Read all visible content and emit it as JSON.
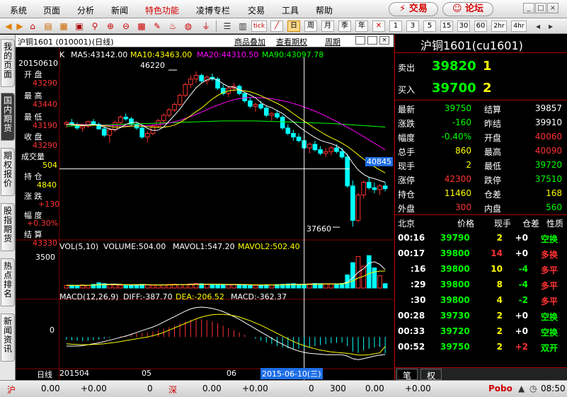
{
  "menu": [
    "系统",
    "页面",
    "分析",
    "新闻",
    "特色功能",
    "凌博专栏",
    "交易",
    "工具",
    "帮助"
  ],
  "menu_highlight_index": 4,
  "top_buttons": {
    "trade": "⚡ 交易",
    "forum": "论坛"
  },
  "toolbar_numbers": [
    "1",
    "3",
    "5",
    "15",
    "30",
    "60",
    "2hr",
    "4hr"
  ],
  "toolbar_day": "日",
  "toolbar_week": "周",
  "toolbar_month": "月",
  "toolbar_season": "季",
  "toolbar_year": "年",
  "toolbar_tick": "tick",
  "left_tabs": [
    "我的页面",
    "国内期货",
    "期权报价",
    "股指期货",
    "热点排名",
    "新闻资讯"
  ],
  "left_tab_active": 1,
  "chart_header": {
    "title": "沪铜1601 (010001)",
    "period": "(日线)",
    "link1": "商品叠加",
    "link2": "查看期权",
    "link3": "周期"
  },
  "chart_data": [
    {
      "type": "candlestick",
      "name": "K",
      "ma_labels": [
        {
          "text": "MA5:43142.00",
          "color": "#ffffff"
        },
        {
          "text": "MA10:43463.00",
          "color": "#ffff00"
        },
        {
          "text": "MA20:44310.50",
          "color": "#ff00ff"
        },
        {
          "text": "MA90:43097.78",
          "color": "#00ff00"
        }
      ],
      "y_cursor_value": "40845",
      "annotation_high": "46220",
      "annotation_low": "37660",
      "x_labels": [
        "201504",
        "05",
        "06"
      ],
      "cursor_date": "2015-06-10(三)",
      "candles": [
        [
          43300,
          43500,
          43100,
          43400
        ],
        [
          43400,
          43600,
          43200,
          43300
        ],
        [
          43300,
          43400,
          43000,
          43100
        ],
        [
          43100,
          43300,
          42900,
          43200
        ],
        [
          43200,
          43500,
          43100,
          43450
        ],
        [
          43450,
          43600,
          43250,
          43300
        ],
        [
          43300,
          43400,
          43000,
          43050
        ],
        [
          43050,
          43200,
          42600,
          42700
        ],
        [
          42700,
          43100,
          42300,
          43000
        ],
        [
          43000,
          43500,
          42900,
          43400
        ],
        [
          43400,
          43800,
          43300,
          43700
        ],
        [
          43700,
          43900,
          43500,
          43600
        ],
        [
          43600,
          43700,
          43200,
          43300
        ],
        [
          43300,
          43400,
          43000,
          43100
        ],
        [
          43100,
          43200,
          42500,
          42600
        ],
        [
          42600,
          42900,
          42300,
          42800
        ],
        [
          42800,
          43300,
          42700,
          43200
        ],
        [
          43200,
          43600,
          43100,
          43500
        ],
        [
          43500,
          43900,
          43400,
          43800
        ],
        [
          43800,
          44200,
          43700,
          44100
        ],
        [
          44100,
          44500,
          44000,
          44400
        ],
        [
          44400,
          45000,
          44300,
          44900
        ],
        [
          44900,
          45600,
          44800,
          45500
        ],
        [
          45500,
          46000,
          45300,
          45800
        ],
        [
          45800,
          46220,
          45600,
          46000
        ],
        [
          46000,
          46100,
          45600,
          45700
        ],
        [
          45700,
          46000,
          45500,
          45900
        ],
        [
          45900,
          46100,
          45700,
          45800
        ],
        [
          45800,
          45900,
          45200,
          45300
        ],
        [
          45300,
          45500,
          44900,
          45000
        ],
        [
          45000,
          45400,
          44800,
          45300
        ],
        [
          45300,
          45600,
          45100,
          45400
        ],
        [
          45400,
          45500,
          44900,
          45000
        ],
        [
          45000,
          45100,
          44500,
          44600
        ],
        [
          44600,
          44800,
          44200,
          44300
        ],
        [
          44300,
          44500,
          44000,
          44400
        ],
        [
          44400,
          44600,
          44100,
          44200
        ],
        [
          44200,
          44300,
          43700,
          43800
        ],
        [
          43800,
          44000,
          43500,
          43900
        ],
        [
          43900,
          44100,
          43600,
          43700
        ],
        [
          43700,
          43800,
          43000,
          43100
        ],
        [
          43100,
          43300,
          42700,
          42800
        ],
        [
          42800,
          43000,
          42400,
          42600
        ],
        [
          42600,
          42800,
          42300,
          42400
        ],
        [
          42400,
          42700,
          41900,
          42000
        ],
        [
          42000,
          42300,
          41700,
          42200
        ],
        [
          42200,
          42400,
          41800,
          41900
        ],
        [
          41900,
          42100,
          41600,
          41700
        ],
        [
          41700,
          42000,
          41500,
          41800
        ],
        [
          41800,
          42100,
          41600,
          42000
        ],
        [
          42000,
          42200,
          41700,
          41800
        ],
        [
          41800,
          42000,
          41400,
          41500
        ],
        [
          41500,
          41700,
          39800,
          39900
        ],
        [
          39900,
          40200,
          37660,
          38000
        ],
        [
          38000,
          39500,
          37900,
          39400
        ],
        [
          39400,
          40200,
          39200,
          40100
        ],
        [
          40100,
          40400,
          39700,
          39800
        ],
        [
          39800,
          40100,
          39500,
          39700
        ],
        [
          39700,
          40000,
          39400,
          39900
        ],
        [
          39900,
          40100,
          39600,
          39750
        ]
      ],
      "ma5": [
        43300,
        43280,
        43250,
        43230,
        43260,
        43300,
        43260,
        43150,
        43050,
        43000,
        43120,
        43300,
        43400,
        43420,
        43260,
        43080,
        42960,
        42980,
        43160,
        43480,
        43800,
        44140,
        44560,
        44940,
        45320,
        45580,
        45760,
        45840,
        45740,
        45540,
        45380,
        45360,
        45200,
        45060,
        44920,
        44760,
        44500,
        44320,
        44220,
        44060,
        43900,
        43660,
        43440,
        43180,
        42960,
        42760,
        42580,
        42420,
        42320,
        42240,
        42120,
        41920,
        41600,
        41160,
        40780,
        40540,
        40380,
        40300,
        40200,
        40100
      ],
      "ma10": [
        43300,
        43300,
        43280,
        43260,
        43260,
        43260,
        43250,
        43220,
        43180,
        43150,
        43150,
        43170,
        43200,
        43220,
        43200,
        43170,
        43140,
        43130,
        43140,
        43180,
        43260,
        43400,
        43580,
        43780,
        44000,
        44200,
        44450,
        44700,
        44900,
        45050,
        45150,
        45200,
        45200,
        45150,
        45100,
        45000,
        44880,
        44740,
        44600,
        44460,
        44300,
        44100,
        43890,
        43680,
        43480,
        43280,
        43080,
        42900,
        42720,
        42560,
        42420,
        42260,
        42080,
        41860,
        41620,
        41380,
        41160,
        40960,
        40780,
        40620
      ],
      "ma20": [
        43300,
        43300,
        43300,
        43290,
        43280,
        43270,
        43260,
        43250,
        43240,
        43230,
        43220,
        43210,
        43210,
        43220,
        43230,
        43240,
        43260,
        43290,
        43330,
        43380,
        43440,
        43520,
        43620,
        43730,
        43850,
        43980,
        44110,
        44240,
        44360,
        44470,
        44570,
        44660,
        44720,
        44760,
        44780,
        44780,
        44770,
        44750,
        44710,
        44660,
        44600,
        44530,
        44450,
        44360,
        44260,
        44150,
        44030,
        43900,
        43760,
        43610,
        43460,
        43300,
        43140,
        42970,
        42800,
        42620,
        42440,
        42260,
        42080,
        41900
      ],
      "ma90": [
        43200,
        43210,
        43220,
        43230,
        43240,
        43250,
        43260,
        43270,
        43280,
        43290,
        43300,
        43310,
        43320,
        43330,
        43340,
        43350,
        43360,
        43370,
        43380,
        43390,
        43400,
        43410,
        43420,
        43430,
        43440,
        43450,
        43460,
        43470,
        43480,
        43490,
        43490,
        43490,
        43490,
        43490,
        43490,
        43490,
        43480,
        43470,
        43460,
        43450,
        43440,
        43430,
        43420,
        43410,
        43400,
        43390,
        43380,
        43370,
        43360,
        43350,
        43330,
        43310,
        43290,
        43270,
        43250,
        43230,
        43210,
        43190,
        43170,
        43150
      ],
      "y_range": [
        37000,
        47000
      ]
    },
    {
      "type": "bar",
      "name": "VOL",
      "label": "VOL(5,10)",
      "volume_label": "VOLUME:504.00",
      "mavol1_label": "MAVOL1:547.20",
      "mavol2_label": "MAVOL2:502.40",
      "y_tick": "3500",
      "values": [
        300,
        320,
        280,
        350,
        300,
        420,
        600,
        500,
        380,
        360,
        300,
        320,
        340,
        380,
        420,
        360,
        300,
        340,
        380,
        420,
        440,
        400,
        380,
        460,
        520,
        480,
        400,
        380,
        420,
        360,
        340,
        380,
        400,
        360,
        320,
        300,
        340,
        380,
        360,
        400,
        420,
        460,
        500,
        380,
        420,
        480,
        520,
        500,
        460,
        440,
        480,
        520,
        1500,
        2900,
        3600,
        2500,
        3700,
        2300,
        1400,
        504
      ],
      "y_range": [
        0,
        4200
      ]
    },
    {
      "type": "bar",
      "name": "MACD",
      "label": "MACD(12,26,9)",
      "diff_label": "DIFF:-387.70",
      "dea_label": "DEA:-206.52",
      "macd_label": "MACD:-362.37",
      "y_tick": "0",
      "values": [
        -60,
        -70,
        -80,
        -90,
        -80,
        -70,
        -60,
        -40,
        -20,
        0,
        20,
        40,
        60,
        80,
        90,
        100,
        120,
        150,
        180,
        220,
        260,
        300,
        340,
        380,
        400,
        390,
        370,
        340,
        300,
        250,
        200,
        150,
        100,
        50,
        0,
        -40,
        -80,
        -120,
        -160,
        -200,
        -230,
        -250,
        -260,
        -260,
        -250,
        -230,
        -200,
        -180,
        -160,
        -140,
        -130,
        -120,
        -200,
        -320,
        -350,
        -300,
        -260,
        -230,
        -220,
        -362
      ],
      "diff": [
        -200,
        -200,
        -200,
        -190,
        -170,
        -150,
        -130,
        -100,
        -70,
        -40,
        -10,
        20,
        60,
        100,
        140,
        180,
        220,
        270,
        330,
        390,
        450,
        510,
        570,
        620,
        650,
        660,
        650,
        630,
        600,
        560,
        510,
        450,
        390,
        320,
        250,
        180,
        110,
        40,
        -30,
        -100,
        -160,
        -220,
        -270,
        -310,
        -340,
        -360,
        -370,
        -380,
        -390,
        -390,
        -390,
        -390,
        -420,
        -480,
        -500,
        -480,
        -450,
        -420,
        -400,
        -387
      ],
      "dea": [
        -150,
        -160,
        -165,
        -170,
        -170,
        -165,
        -160,
        -150,
        -135,
        -120,
        -100,
        -80,
        -60,
        -40,
        -20,
        0,
        30,
        60,
        100,
        150,
        200,
        250,
        300,
        350,
        400,
        440,
        470,
        490,
        500,
        500,
        490,
        470,
        440,
        400,
        360,
        310,
        260,
        200,
        140,
        80,
        20,
        -40,
        -100,
        -150,
        -190,
        -230,
        -260,
        -290,
        -310,
        -330,
        -340,
        -350,
        -360,
        -380,
        -400,
        -400,
        -390,
        -370,
        -350,
        -206
      ],
      "y_range": [
        -700,
        800
      ]
    }
  ],
  "y_axis_info": {
    "date": "20150610",
    "open_label": "开 盘",
    "open": "43290",
    "high_label": "最 高",
    "high": "43440",
    "low_label": "最 低",
    "low": "43190",
    "close_label": "收 盘",
    "close": "43290",
    "volume_label": "成交量",
    "volume": "504",
    "oi_label": "持 仓",
    "oi": "4840",
    "change_label": "涨 跌",
    "change": "+130",
    "pct_label": "幅 度",
    "pct": "+0.30%",
    "settle_label": "结 算",
    "settle": "43330"
  },
  "bottom_tab": "日线",
  "quote": {
    "title": "沪铜1601(cu1601)",
    "ask_label": "卖出",
    "ask": "39820",
    "ask_vol": "1",
    "bid_label": "买入",
    "bid": "39700",
    "bid_vol": "2",
    "rows": [
      [
        "最新",
        "39750",
        "结算",
        "39857"
      ],
      [
        "涨跌",
        "-160",
        "昨结",
        "39910"
      ],
      [
        "幅度",
        "-0.40%",
        "开盘",
        "40060"
      ],
      [
        "总手",
        "860",
        "最高",
        "40090"
      ],
      [
        "现手",
        "2",
        "最低",
        "39720"
      ],
      [
        "涨停",
        "42300",
        "跌停",
        "37510"
      ],
      [
        "持仓",
        "11460",
        "仓差",
        "168"
      ],
      [
        "外盘",
        "300",
        "内盘",
        "560"
      ]
    ],
    "tick_headers": [
      "北京",
      "价格",
      "现手",
      "仓差",
      "性质"
    ],
    "ticks": [
      [
        "00:16",
        "39790",
        "2",
        "+0",
        "空换"
      ],
      [
        "00:17",
        "39800",
        "14",
        "+0",
        "多换"
      ],
      [
        ":16",
        "39800",
        "10",
        "-4",
        "多平"
      ],
      [
        ":29",
        "39800",
        "8",
        "-4",
        "多平"
      ],
      [
        ":30",
        "39800",
        "4",
        "-2",
        "多平"
      ],
      [
        "00:28",
        "39730",
        "2",
        "+0",
        "空换"
      ],
      [
        "00:33",
        "39720",
        "2",
        "+0",
        "空换"
      ],
      [
        "00:52",
        "39750",
        "2",
        "+2",
        "双开"
      ]
    ],
    "bottom_tabs": [
      "笔",
      "权"
    ]
  },
  "status": {
    "sh": "沪",
    "sh_v1": "0.00",
    "sh_v2": "+0.00",
    "sh_v3": "0",
    "sz": "深",
    "sz_v1": "0.00",
    "sz_v2": "+0.00",
    "sz_v3": "0",
    "n": "300",
    "n_v1": "0.00",
    "n_v2": "+0.00",
    "brand": "Pobo",
    "time": "08:50"
  },
  "colors": {
    "up": "#ff3232",
    "down": "#00ffff",
    "yellow": "#ffff00",
    "green": "#00ff00",
    "grid": "#800000"
  }
}
